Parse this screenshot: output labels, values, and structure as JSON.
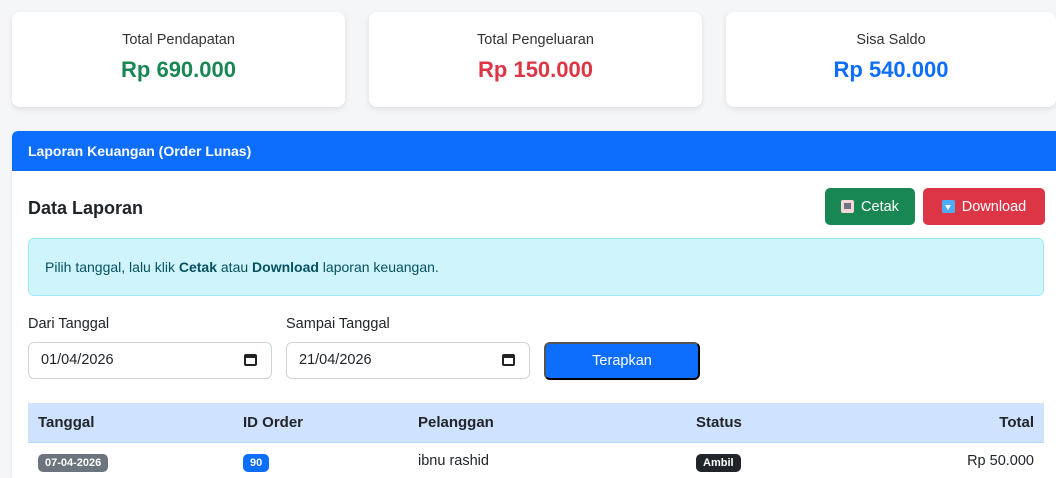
{
  "summary": {
    "income": {
      "label": "Total Pendapatan",
      "value": "Rp 690.000",
      "color": "#198754"
    },
    "expense": {
      "label": "Total Pengeluaran",
      "value": "Rp 150.000",
      "color": "#dc3545"
    },
    "balance": {
      "label": "Sisa Saldo",
      "value": "Rp 540.000",
      "color": "#0d6efd"
    }
  },
  "report": {
    "header": "Laporan Keuangan (Order Lunas)",
    "title": "Data Laporan",
    "print_label": "Cetak",
    "print_icon": "printer-icon",
    "download_label": "Download",
    "download_icon": "download-icon",
    "alert": {
      "prefix": "Pilih tanggal, lalu klik ",
      "strong1": "Cetak",
      "middle": " atau ",
      "strong2": "Download",
      "suffix": " laporan keuangan."
    },
    "filter": {
      "from_label": "Dari Tanggal",
      "from_value": "01/04/2026",
      "to_label": "Sampai Tanggal",
      "to_value": "21/04/2026",
      "calendar_icon": "calendar-icon",
      "apply_label": "Terapkan"
    },
    "table": {
      "columns": [
        "Tanggal",
        "ID Order",
        "Pelanggan",
        "Status",
        "Total"
      ],
      "rows": [
        {
          "date": "07-04-2026",
          "order_id": "90",
          "customer": "ibnu rashid",
          "status": "Ambil",
          "total": "Rp 50.000"
        }
      ]
    }
  }
}
